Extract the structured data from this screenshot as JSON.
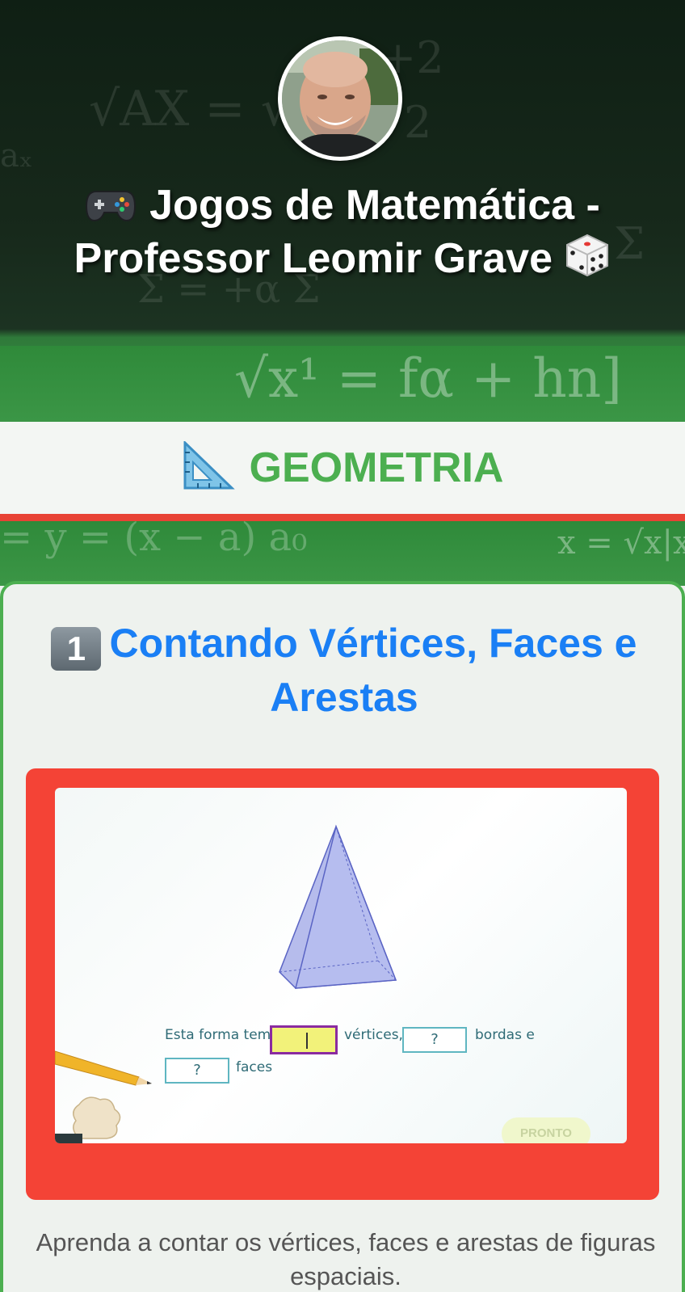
{
  "header": {
    "title_line1": "Jogos de Matemática -",
    "title_line2": "Professor Leomir Grave",
    "icon_left": "video-game-controller-icon",
    "icon_right": "dice-icon"
  },
  "section": {
    "title": "GEOMETRIA",
    "icon": "triangle-ruler-icon",
    "color": "#4caf50",
    "bar_color": "#e84335"
  },
  "card": {
    "number": "1",
    "title": "Contando Vértices, Faces e Arestas",
    "title_color": "#1a7ff5",
    "border_color": "#4caf50",
    "frame_color": "#f44336",
    "description": "Aprenda a contar os vértices, faces e arestas de figuras espaciais."
  },
  "game": {
    "prompt_start": "Esta forma tem",
    "vertices_label": "vértices,",
    "edges_placeholder": "?",
    "edges_label": "bordas e",
    "faces_placeholder": "?",
    "faces_label": "faces",
    "submit_label": "PRONTO"
  }
}
